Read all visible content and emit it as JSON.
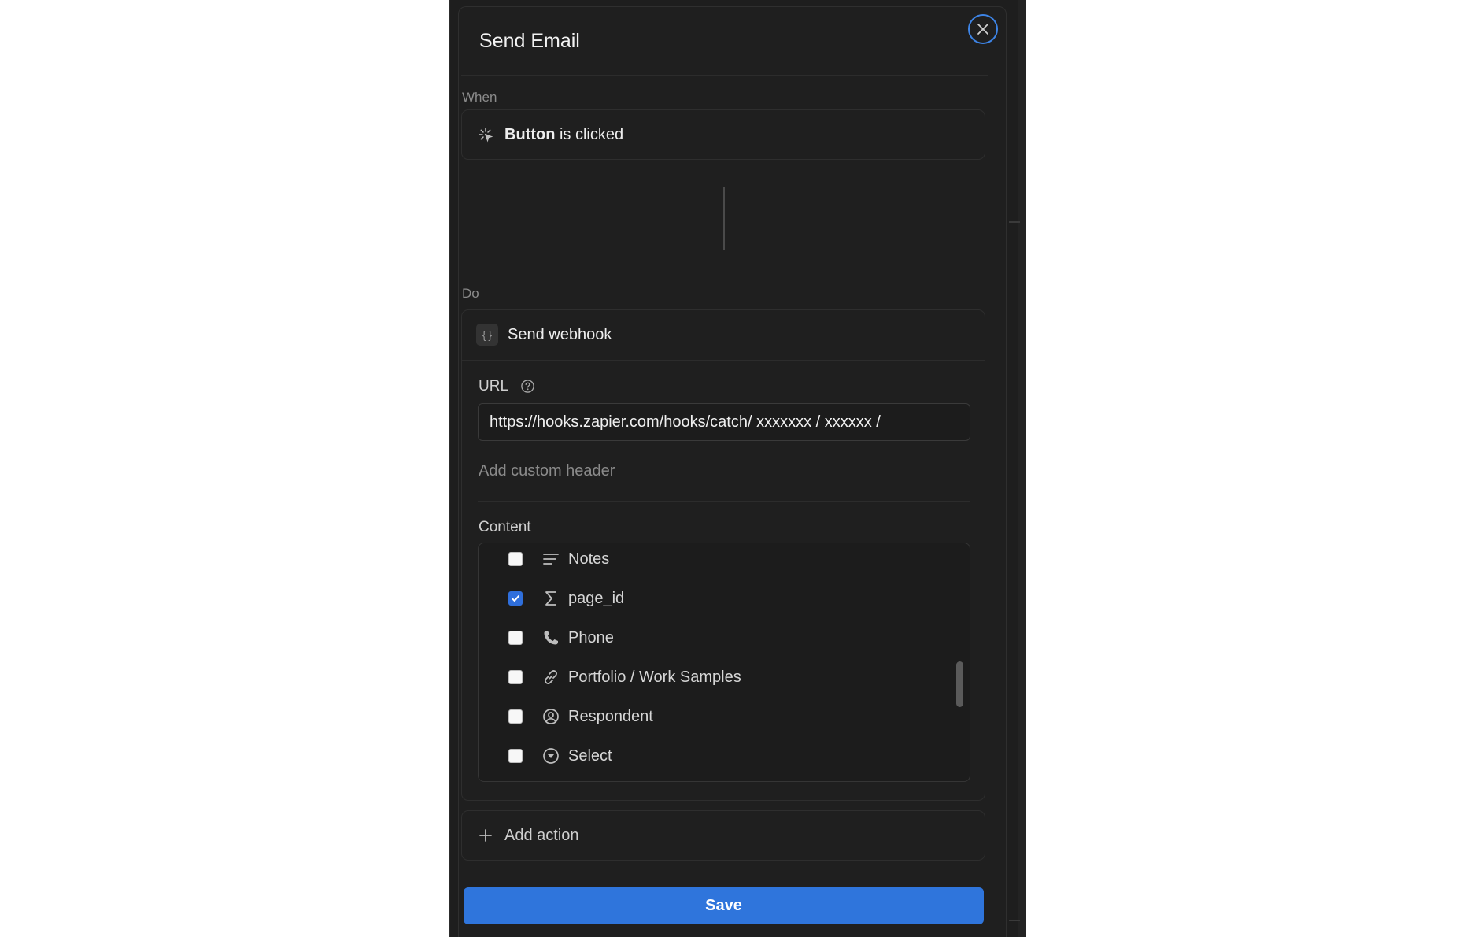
{
  "dialog": {
    "title": "Send Email",
    "close_icon": "close-icon",
    "accent_color": "#3d84e6"
  },
  "trigger": {
    "section_label": "When",
    "icon": "click-sparkle-icon",
    "name_bold": "Button",
    "name_rest": " is clicked"
  },
  "action": {
    "section_label": "Do",
    "icon": "webhook-braces-icon",
    "title": "Send webhook",
    "url_label": "URL",
    "url_help_icon": "help-circle-icon",
    "url_value": "https://hooks.zapier.com/hooks/catch/ xxxxxxx / xxxxxx /",
    "custom_header_label": "Add custom header",
    "content_label": "Content",
    "content_items": [
      {
        "label": "Notes",
        "icon": "text-lines-icon",
        "checked": false
      },
      {
        "label": "page_id",
        "icon": "sigma-icon",
        "checked": true
      },
      {
        "label": "Phone",
        "icon": "phone-icon",
        "checked": false
      },
      {
        "label": "Portfolio / Work Samples",
        "icon": "link-icon",
        "checked": false
      },
      {
        "label": "Respondent",
        "icon": "person-circle-icon",
        "checked": false
      },
      {
        "label": "Select",
        "icon": "select-circle-icon",
        "checked": false
      }
    ]
  },
  "add_action": {
    "icon": "plus-icon",
    "label": "Add action"
  },
  "save": {
    "label": "Save",
    "color": "#2f75dc"
  }
}
